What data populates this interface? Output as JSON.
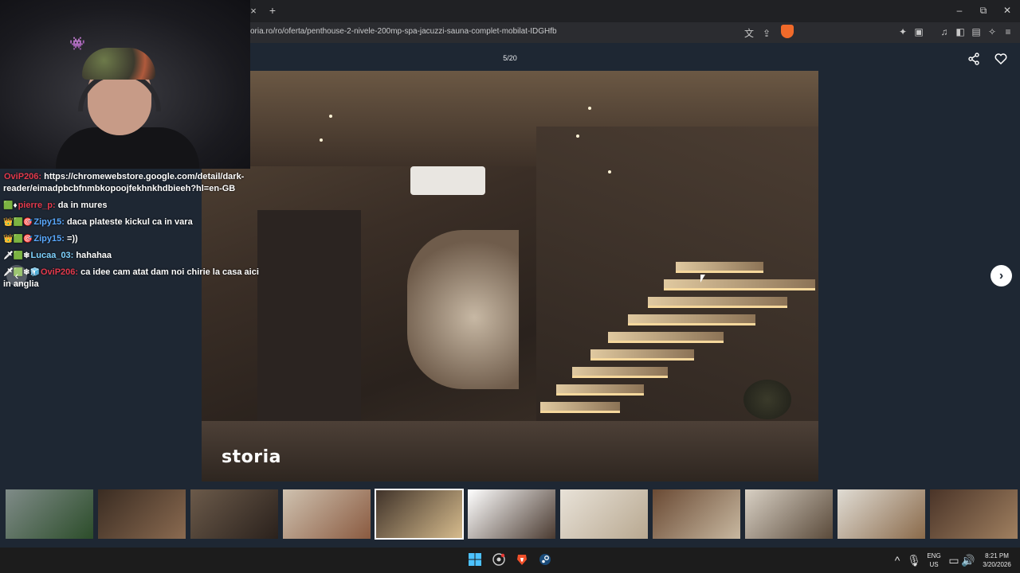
{
  "browser": {
    "tab_close_icon": "×",
    "new_tab_icon": "+",
    "url": "oria.ro/ro/oferta/penthouse-2-nivele-200mp-spa-jacuzzi-sauna-complet-mobilat-IDGHfb",
    "window_controls": {
      "minimize": "–",
      "maximize": "⧉",
      "close": "✕"
    },
    "toolbar_icons": [
      "translate-icon",
      "share-page-icon",
      "brave-shield-icon",
      "extensions-icon",
      "tab-manager-icon",
      "media-icon",
      "sidebar-icon",
      "wallet-icon",
      "leo-icon",
      "menu-icon"
    ]
  },
  "gallery": {
    "counter": "5/20",
    "watermark": "storia",
    "share_glyph": "⋖",
    "heart_glyph": "♡",
    "next_glyph": "›",
    "prev_glyph": "‹",
    "thumbnails": [
      {
        "label": "thumb-1",
        "active": false,
        "colors": [
          "#7f8b88",
          "#2c4d2a"
        ]
      },
      {
        "label": "thumb-2",
        "active": false,
        "colors": [
          "#3a2c22",
          "#8a6a50"
        ]
      },
      {
        "label": "thumb-3",
        "active": false,
        "colors": [
          "#6b5a4a",
          "#2a211c"
        ]
      },
      {
        "label": "thumb-4",
        "active": false,
        "colors": [
          "#cfc2b0",
          "#8a5a40"
        ]
      },
      {
        "label": "thumb-5",
        "active": true,
        "colors": [
          "#3e3128",
          "#d8bd8e"
        ]
      },
      {
        "label": "thumb-6",
        "active": false,
        "colors": [
          "#ffffff",
          "#4a3a30"
        ]
      },
      {
        "label": "thumb-7",
        "active": false,
        "colors": [
          "#e8e2d8",
          "#b8a890"
        ]
      },
      {
        "label": "thumb-8",
        "active": false,
        "colors": [
          "#6a4a34",
          "#c8b8a0"
        ]
      },
      {
        "label": "thumb-9",
        "active": false,
        "colors": [
          "#d8d0c4",
          "#5a4a3a"
        ]
      },
      {
        "label": "thumb-10",
        "active": false,
        "colors": [
          "#e0dcd4",
          "#8a6a4a"
        ]
      },
      {
        "label": "thumb-11",
        "active": false,
        "colors": [
          "#4a3428",
          "#a08060"
        ]
      }
    ]
  },
  "chat": {
    "messages": [
      {
        "badges": "",
        "user": "OviP206:",
        "user_color": "#e23a4d",
        "text": "https://chromewebstore.google.com/detail/dark-reader/eimadpbcbfnmbkopoojfekhnkhdbieeh?hl=en-GB"
      },
      {
        "badges": "🟩♦",
        "user": "pierre_p:",
        "user_color": "#e23a4d",
        "text": "da in mures"
      },
      {
        "badges": "👑🟩🎯",
        "user": "Zipy15:",
        "user_color": "#5aa9ff",
        "text": "daca plateste kickul ca in vara"
      },
      {
        "badges": "👑🟩🎯",
        "user": "Zipy15:",
        "user_color": "#5aa9ff",
        "text": "=))"
      },
      {
        "badges": "🗡🟩❄",
        "user": "Lucaa_03:",
        "user_color": "#7fd3ff",
        "text": "hahahaa"
      },
      {
        "badges": "🗡🟩❄🧊",
        "user": "OviP206:",
        "user_color": "#e23a4d",
        "text": "ca idee cam atat dam noi chirie la casa aici in anglia"
      }
    ]
  },
  "taskbar": {
    "lang_line1": "ENG",
    "lang_line2": "US",
    "time": "8:21 PM",
    "date": "3/20/2026",
    "icons": [
      "windows-start-icon",
      "chrome-icon",
      "brave-icon",
      "steam-icon"
    ],
    "tray_icons": [
      "chevron-up-icon",
      "mic-icon",
      "monitor-icon",
      "volume-icon"
    ]
  }
}
